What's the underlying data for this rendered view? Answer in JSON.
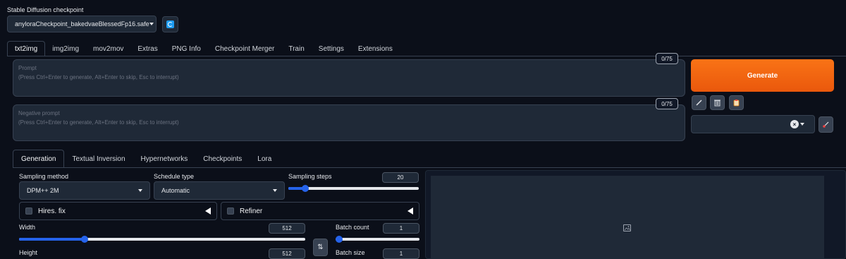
{
  "checkpoint": {
    "label": "Stable Diffusion checkpoint",
    "value": "anyloraCheckpoint_bakedvaeBlessedFp16.safe",
    "refresh_icon": "refresh-icon"
  },
  "top_tabs": [
    "txt2img",
    "img2img",
    "mov2mov",
    "Extras",
    "PNG Info",
    "Checkpoint Merger",
    "Train",
    "Settings",
    "Extensions"
  ],
  "active_top_tab": "txt2img",
  "prompt": {
    "title": "Prompt",
    "hint": "(Press Ctrl+Enter to generate, Alt+Enter to skip, Esc to interrupt)",
    "counter": "0/75"
  },
  "negative_prompt": {
    "title": "Negative prompt",
    "hint": "(Press Ctrl+Enter to generate, Alt+Enter to skip, Esc to interrupt)",
    "counter": "0/75"
  },
  "generate_label": "Generate",
  "tools": {
    "icons": [
      "pencil-icon",
      "trash-icon",
      "clipboard-icon"
    ],
    "style_clear": "×",
    "brush_icon": "paintbrush-icon"
  },
  "sub_tabs": [
    "Generation",
    "Textual Inversion",
    "Hypernetworks",
    "Checkpoints",
    "Lora"
  ],
  "active_sub_tab": "Generation",
  "sampling_method": {
    "label": "Sampling method",
    "value": "DPM++ 2M"
  },
  "schedule_type": {
    "label": "Schedule type",
    "value": "Automatic"
  },
  "sampling_steps": {
    "label": "Sampling steps",
    "value": "20",
    "fraction": 0.13
  },
  "hires_fix": {
    "label": "Hires. fix"
  },
  "refiner": {
    "label": "Refiner"
  },
  "width": {
    "label": "Width",
    "value": "512",
    "fraction": 0.23
  },
  "height": {
    "label": "Height",
    "value": "512"
  },
  "batch_count": {
    "label": "Batch count",
    "value": "1",
    "fraction": 0.0
  },
  "batch_size": {
    "label": "Batch size",
    "value": "1"
  },
  "swap_icon": "⇅",
  "output": {
    "placeholder_icon": "image-icon"
  },
  "colors": {
    "accent": "#2563eb",
    "generate": "#f97316",
    "background": "#0b0f19",
    "panel": "#1f2937"
  }
}
